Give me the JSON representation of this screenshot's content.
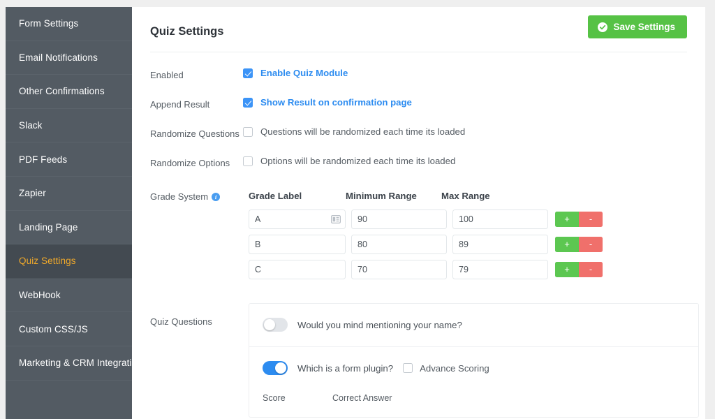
{
  "sidebar": {
    "items": [
      {
        "label": "Form Settings",
        "active": false
      },
      {
        "label": "Email Notifications",
        "active": false
      },
      {
        "label": "Other Confirmations",
        "active": false
      },
      {
        "label": "Slack",
        "active": false
      },
      {
        "label": "PDF Feeds",
        "active": false
      },
      {
        "label": "Zapier",
        "active": false
      },
      {
        "label": "Landing Page",
        "active": false
      },
      {
        "label": "Quiz Settings",
        "active": true
      },
      {
        "label": "WebHook",
        "active": false
      },
      {
        "label": "Custom CSS/JS",
        "active": false
      },
      {
        "label": "Marketing & CRM Integrations",
        "active": false
      }
    ]
  },
  "header": {
    "title": "Quiz Settings",
    "save_label": "Save Settings",
    "save_icon": "check-circle-icon"
  },
  "settings": {
    "enabled": {
      "label": "Enabled",
      "checkbox_label": "Enable Quiz Module",
      "checked": true
    },
    "append_result": {
      "label": "Append Result",
      "checkbox_label": "Show Result on confirmation page",
      "checked": true
    },
    "randomize_questions": {
      "label": "Randomize Questions",
      "checkbox_label": "Questions will be randomized each time its loaded",
      "checked": false
    },
    "randomize_options": {
      "label": "Randomize Options",
      "checkbox_label": "Options will be randomized each time its loaded",
      "checked": false
    }
  },
  "grade_system": {
    "label": "Grade System",
    "info_icon": "info-icon",
    "info_glyph": "i",
    "columns": [
      "Grade Label",
      "Minimum Range",
      "Max Range"
    ],
    "rows": [
      {
        "grade": "A",
        "min": "90",
        "max": "100",
        "has_tag_icon": true,
        "add_label": "+",
        "remove_label": "-"
      },
      {
        "grade": "B",
        "min": "80",
        "max": "89",
        "has_tag_icon": false,
        "add_label": "+",
        "remove_label": "-"
      },
      {
        "grade": "C",
        "min": "70",
        "max": "79",
        "has_tag_icon": false,
        "add_label": "+",
        "remove_label": "-"
      }
    ]
  },
  "quiz_questions": {
    "label": "Quiz Questions",
    "items": [
      {
        "question": "Would you mind mentioning your name?",
        "enabled": false,
        "has_advance_scoring": false
      },
      {
        "question": "Which is a form plugin?",
        "enabled": true,
        "has_advance_scoring": true,
        "advance_scoring_label": "Advance Scoring",
        "advance_scoring_checked": false,
        "score_label": "Score",
        "correct_answer_label": "Correct Answer"
      }
    ]
  },
  "colors": {
    "sidebar_bg": "#535b63",
    "sidebar_active_bg": "#434a51",
    "sidebar_active_text": "#f0a92a",
    "accent_blue": "#2d8cf0",
    "save_green": "#56c245",
    "add_green": "#5cc751",
    "remove_red": "#f0706b"
  }
}
